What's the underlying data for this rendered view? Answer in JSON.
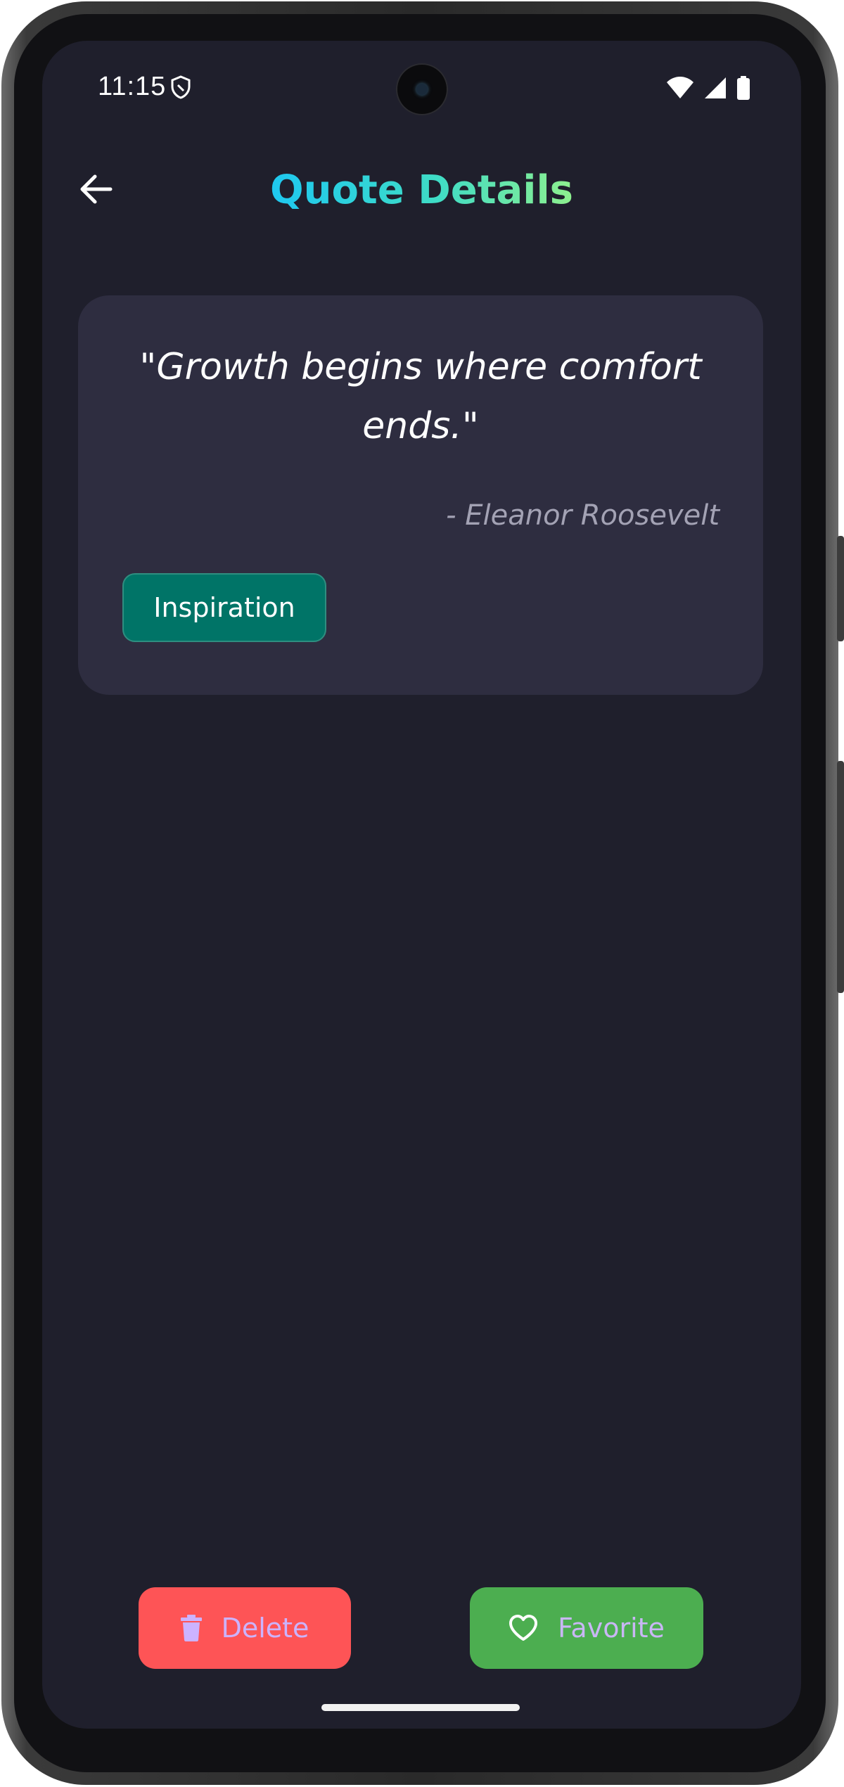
{
  "status_bar": {
    "time": "11:15",
    "icons": [
      "shield-icon",
      "wifi-icon",
      "cellular-signal-icon",
      "battery-icon"
    ]
  },
  "header": {
    "back_icon": "arrow-left-icon",
    "title": "Quote Details",
    "title_gradient": [
      "#1ec8f0",
      "#3fdcc6",
      "#8ef08e"
    ]
  },
  "quote": {
    "text": "\"Growth begins where comfort ends.\"",
    "author": "- Eleanor Roosevelt",
    "category": "Inspiration"
  },
  "actions": {
    "delete_label": "Delete",
    "delete_icon": "trash-icon",
    "favorite_label": "Favorite",
    "favorite_icon": "heart-outline-icon"
  },
  "colors": {
    "background": "#1f1f2c",
    "card": "#2e2d40",
    "chip": "#007467",
    "delete": "#fe5456",
    "favorite": "#4cae50"
  }
}
